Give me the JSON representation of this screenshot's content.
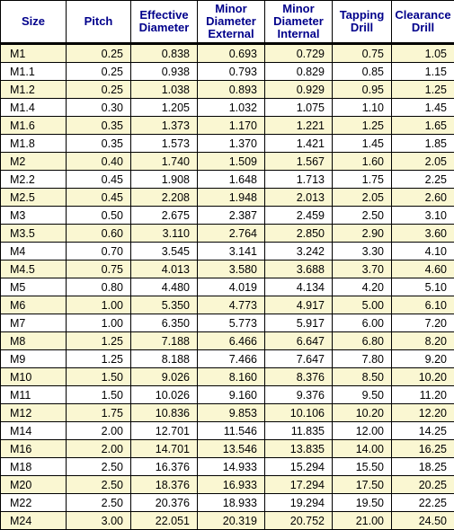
{
  "table": {
    "columns": [
      {
        "key": "size",
        "label": "Size",
        "align": "left"
      },
      {
        "key": "pitch",
        "label": "Pitch",
        "align": "right"
      },
      {
        "key": "effective",
        "label": "Effective Diameter",
        "align": "right"
      },
      {
        "key": "minor_ext",
        "label": "Minor Diameter External",
        "align": "right"
      },
      {
        "key": "minor_int",
        "label": "Minor Diameter Internal",
        "align": "right"
      },
      {
        "key": "tapping",
        "label": "Tapping Drill",
        "align": "right"
      },
      {
        "key": "clearance",
        "label": "Clearance Drill",
        "align": "right"
      }
    ],
    "colors": {
      "header_text": "#00008b",
      "header_background": "#ffffff",
      "row_stripe": "#faf7d2",
      "row_alt": "#ffffff",
      "border": "#000000",
      "body_text": "#000000"
    },
    "rows": [
      {
        "size": "M1",
        "pitch": "0.25",
        "effective": "0.838",
        "minor_ext": "0.693",
        "minor_int": "0.729",
        "tapping": "0.75",
        "clearance": "1.05"
      },
      {
        "size": "M1.1",
        "pitch": "0.25",
        "effective": "0.938",
        "minor_ext": "0.793",
        "minor_int": "0.829",
        "tapping": "0.85",
        "clearance": "1.15"
      },
      {
        "size": "M1.2",
        "pitch": "0.25",
        "effective": "1.038",
        "minor_ext": "0.893",
        "minor_int": "0.929",
        "tapping": "0.95",
        "clearance": "1.25"
      },
      {
        "size": "M1.4",
        "pitch": "0.30",
        "effective": "1.205",
        "minor_ext": "1.032",
        "minor_int": "1.075",
        "tapping": "1.10",
        "clearance": "1.45"
      },
      {
        "size": "M1.6",
        "pitch": "0.35",
        "effective": "1.373",
        "minor_ext": "1.170",
        "minor_int": "1.221",
        "tapping": "1.25",
        "clearance": "1.65"
      },
      {
        "size": "M1.8",
        "pitch": "0.35",
        "effective": "1.573",
        "minor_ext": "1.370",
        "minor_int": "1.421",
        "tapping": "1.45",
        "clearance": "1.85"
      },
      {
        "size": "M2",
        "pitch": "0.40",
        "effective": "1.740",
        "minor_ext": "1.509",
        "minor_int": "1.567",
        "tapping": "1.60",
        "clearance": "2.05"
      },
      {
        "size": "M2.2",
        "pitch": "0.45",
        "effective": "1.908",
        "minor_ext": "1.648",
        "minor_int": "1.713",
        "tapping": "1.75",
        "clearance": "2.25"
      },
      {
        "size": "M2.5",
        "pitch": "0.45",
        "effective": "2.208",
        "minor_ext": "1.948",
        "minor_int": "2.013",
        "tapping": "2.05",
        "clearance": "2.60"
      },
      {
        "size": "M3",
        "pitch": "0.50",
        "effective": "2.675",
        "minor_ext": "2.387",
        "minor_int": "2.459",
        "tapping": "2.50",
        "clearance": "3.10"
      },
      {
        "size": "M3.5",
        "pitch": "0.60",
        "effective": "3.110",
        "minor_ext": "2.764",
        "minor_int": "2.850",
        "tapping": "2.90",
        "clearance": "3.60"
      },
      {
        "size": "M4",
        "pitch": "0.70",
        "effective": "3.545",
        "minor_ext": "3.141",
        "minor_int": "3.242",
        "tapping": "3.30",
        "clearance": "4.10"
      },
      {
        "size": "M4.5",
        "pitch": "0.75",
        "effective": "4.013",
        "minor_ext": "3.580",
        "minor_int": "3.688",
        "tapping": "3.70",
        "clearance": "4.60"
      },
      {
        "size": "M5",
        "pitch": "0.80",
        "effective": "4.480",
        "minor_ext": "4.019",
        "minor_int": "4.134",
        "tapping": "4.20",
        "clearance": "5.10"
      },
      {
        "size": "M6",
        "pitch": "1.00",
        "effective": "5.350",
        "minor_ext": "4.773",
        "minor_int": "4.917",
        "tapping": "5.00",
        "clearance": "6.10"
      },
      {
        "size": "M7",
        "pitch": "1.00",
        "effective": "6.350",
        "minor_ext": "5.773",
        "minor_int": "5.917",
        "tapping": "6.00",
        "clearance": "7.20"
      },
      {
        "size": "M8",
        "pitch": "1.25",
        "effective": "7.188",
        "minor_ext": "6.466",
        "minor_int": "6.647",
        "tapping": "6.80",
        "clearance": "8.20"
      },
      {
        "size": "M9",
        "pitch": "1.25",
        "effective": "8.188",
        "minor_ext": "7.466",
        "minor_int": "7.647",
        "tapping": "7.80",
        "clearance": "9.20"
      },
      {
        "size": "M10",
        "pitch": "1.50",
        "effective": "9.026",
        "minor_ext": "8.160",
        "minor_int": "8.376",
        "tapping": "8.50",
        "clearance": "10.20"
      },
      {
        "size": "M11",
        "pitch": "1.50",
        "effective": "10.026",
        "minor_ext": "9.160",
        "minor_int": "9.376",
        "tapping": "9.50",
        "clearance": "11.20"
      },
      {
        "size": "M12",
        "pitch": "1.75",
        "effective": "10.836",
        "minor_ext": "9.853",
        "minor_int": "10.106",
        "tapping": "10.20",
        "clearance": "12.20"
      },
      {
        "size": "M14",
        "pitch": "2.00",
        "effective": "12.701",
        "minor_ext": "11.546",
        "minor_int": "11.835",
        "tapping": "12.00",
        "clearance": "14.25"
      },
      {
        "size": "M16",
        "pitch": "2.00",
        "effective": "14.701",
        "minor_ext": "13.546",
        "minor_int": "13.835",
        "tapping": "14.00",
        "clearance": "16.25"
      },
      {
        "size": "M18",
        "pitch": "2.50",
        "effective": "16.376",
        "minor_ext": "14.933",
        "minor_int": "15.294",
        "tapping": "15.50",
        "clearance": "18.25"
      },
      {
        "size": "M20",
        "pitch": "2.50",
        "effective": "18.376",
        "minor_ext": "16.933",
        "minor_int": "17.294",
        "tapping": "17.50",
        "clearance": "20.25"
      },
      {
        "size": "M22",
        "pitch": "2.50",
        "effective": "20.376",
        "minor_ext": "18.933",
        "minor_int": "19.294",
        "tapping": "19.50",
        "clearance": "22.25"
      },
      {
        "size": "M24",
        "pitch": "3.00",
        "effective": "22.051",
        "minor_ext": "20.319",
        "minor_int": "20.752",
        "tapping": "21.00",
        "clearance": "24.50"
      }
    ]
  }
}
